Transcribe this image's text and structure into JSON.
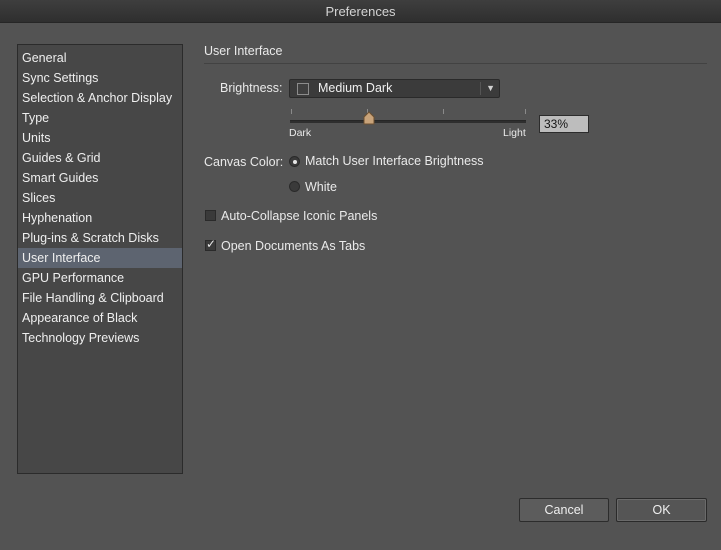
{
  "window": {
    "title": "Preferences"
  },
  "sidebar": {
    "items": [
      {
        "label": "General"
      },
      {
        "label": "Sync Settings"
      },
      {
        "label": "Selection & Anchor Display"
      },
      {
        "label": "Type"
      },
      {
        "label": "Units"
      },
      {
        "label": "Guides & Grid"
      },
      {
        "label": "Smart Guides"
      },
      {
        "label": "Slices"
      },
      {
        "label": "Hyphenation"
      },
      {
        "label": "Plug-ins & Scratch Disks"
      },
      {
        "label": "User Interface",
        "selected": true
      },
      {
        "label": "GPU Performance"
      },
      {
        "label": "File Handling & Clipboard"
      },
      {
        "label": "Appearance of Black"
      },
      {
        "label": "Technology Previews"
      }
    ]
  },
  "panel": {
    "title": "User Interface",
    "brightness": {
      "label": "Brightness:",
      "selected": "Medium Dark",
      "slider_min_label": "Dark",
      "slider_max_label": "Light",
      "value_text": "33%",
      "value": 33
    },
    "canvas_color": {
      "label": "Canvas Color:",
      "options": [
        {
          "label": "Match User Interface Brightness",
          "checked": true
        },
        {
          "label": "White",
          "checked": false
        }
      ]
    },
    "auto_collapse": {
      "label": "Auto-Collapse Iconic Panels",
      "checked": false
    },
    "open_as_tabs": {
      "label": "Open Documents As Tabs",
      "checked": true
    }
  },
  "buttons": {
    "cancel": "Cancel",
    "ok": "OK"
  },
  "colors": {
    "window_bg": "#535353",
    "sidebar_bg": "#474747",
    "selection": "#5d6470",
    "thumb": "#c8a37a"
  }
}
